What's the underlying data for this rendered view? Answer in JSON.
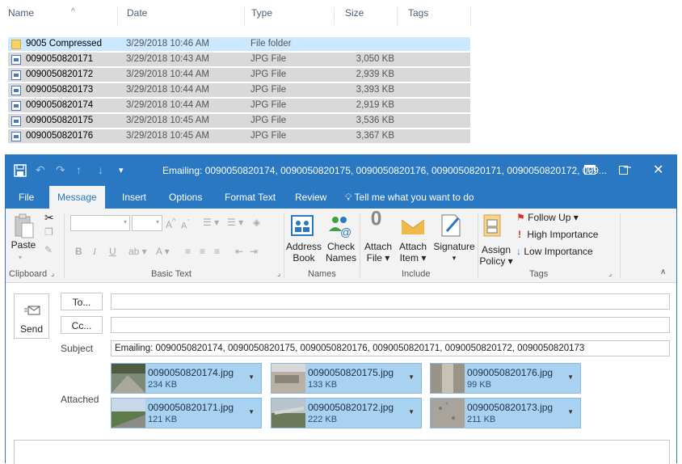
{
  "explorer": {
    "columns": [
      "Name",
      "Date",
      "Type",
      "Size",
      "Tags"
    ],
    "sort_icon": "^",
    "rows": [
      {
        "name": "9005 Compressed",
        "date": "3/29/2018 10:46 AM",
        "type": "File folder",
        "size": "",
        "icon": "folder-icon"
      },
      {
        "name": "0090050820171",
        "date": "3/29/2018 10:43 AM",
        "type": "JPG File",
        "size": "3,050 KB",
        "icon": "jpg-file-icon"
      },
      {
        "name": "0090050820172",
        "date": "3/29/2018 10:44 AM",
        "type": "JPG File",
        "size": "2,939 KB",
        "icon": "jpg-file-icon"
      },
      {
        "name": "0090050820173",
        "date": "3/29/2018 10:44 AM",
        "type": "JPG File",
        "size": "3,393 KB",
        "icon": "jpg-file-icon"
      },
      {
        "name": "0090050820174",
        "date": "3/29/2018 10:44 AM",
        "type": "JPG File",
        "size": "2,919 KB",
        "icon": "jpg-file-icon"
      },
      {
        "name": "0090050820175",
        "date": "3/29/2018 10:45 AM",
        "type": "JPG File",
        "size": "3,536 KB",
        "icon": "jpg-file-icon"
      },
      {
        "name": "0090050820176",
        "date": "3/29/2018 10:45 AM",
        "type": "JPG File",
        "size": "3,367 KB",
        "icon": "jpg-file-icon"
      }
    ]
  },
  "window": {
    "title": "Emailing: 0090050820174, 0090050820175, 0090050820176, 0090050820171, 0090050820172, 009...",
    "accent": "#2b78c2"
  },
  "tabs": [
    "File",
    "Message",
    "Insert",
    "Options",
    "Format Text",
    "Review"
  ],
  "tell_me": "Tell me what you want to do",
  "ribbon": {
    "paste": "Paste",
    "address_book": [
      "Address",
      "Book"
    ],
    "check_names": [
      "Check",
      "Names"
    ],
    "attach_file": [
      "Attach",
      "File ▾"
    ],
    "attach_item": [
      "Attach",
      "Item ▾"
    ],
    "signature": [
      "Signature",
      "▾"
    ],
    "assign_policy": [
      "Assign",
      "Policy ▾"
    ],
    "follow_up": "Follow Up ▾",
    "high_importance": "High Importance",
    "low_importance": "Low Importance",
    "groups": [
      "Clipboard",
      "Basic Text",
      "Names",
      "Include",
      "Tags"
    ]
  },
  "form": {
    "send": "Send",
    "to": "To...",
    "cc": "Cc...",
    "to_value": "",
    "cc_value": "",
    "subject_label": "Subject",
    "subject_value": "Emailing: 0090050820174, 0090050820175, 0090050820176, 0090050820171, 0090050820172, 0090050820173",
    "attached_label": "Attached",
    "attachments": [
      {
        "name": "0090050820174.jpg",
        "size": "234 KB"
      },
      {
        "name": "0090050820175.jpg",
        "size": "133 KB"
      },
      {
        "name": "0090050820176.jpg",
        "size": "99 KB"
      },
      {
        "name": "0090050820171.jpg",
        "size": "121 KB"
      },
      {
        "name": "0090050820172.jpg",
        "size": "222 KB"
      },
      {
        "name": "0090050820173.jpg",
        "size": "211 KB"
      }
    ]
  }
}
